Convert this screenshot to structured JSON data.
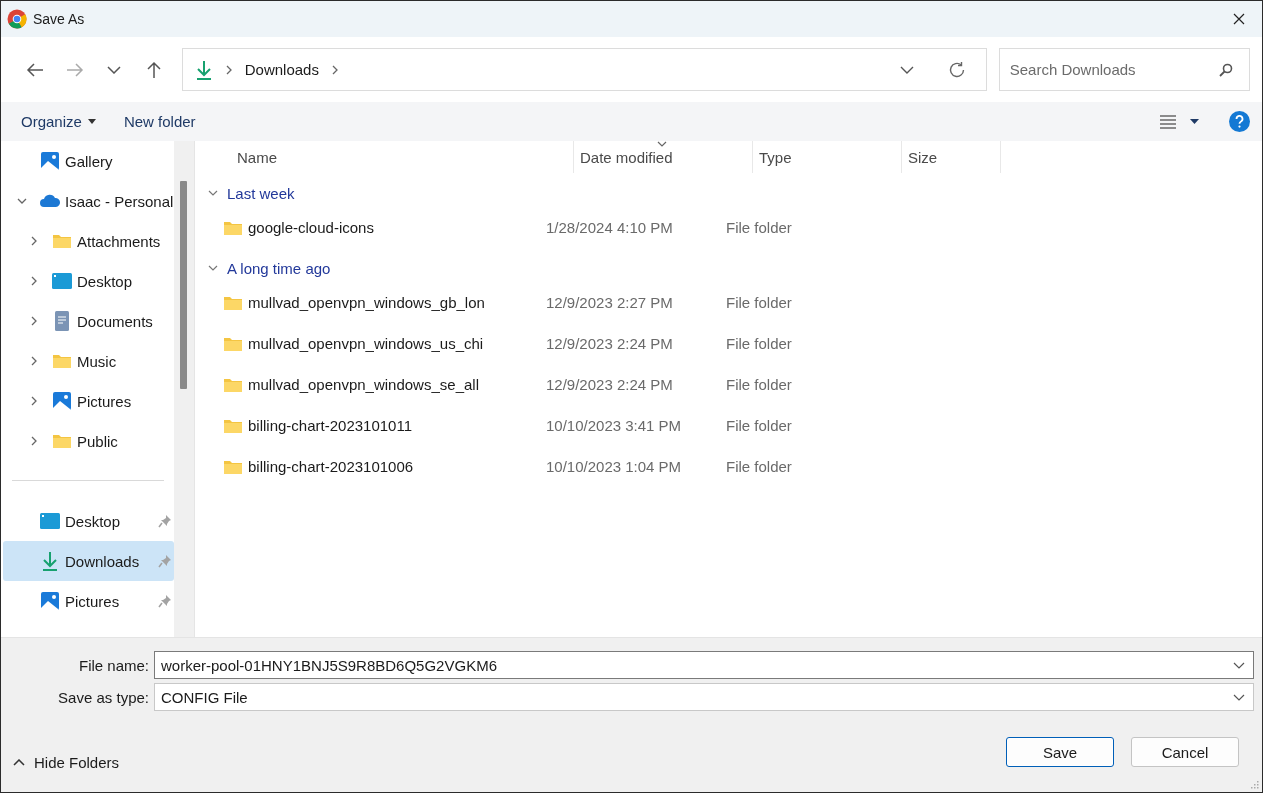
{
  "window": {
    "title": "Save As"
  },
  "address_bar": {
    "path": [
      "Downloads"
    ]
  },
  "search": {
    "placeholder": "Search Downloads"
  },
  "toolbar": {
    "organize": "Organize",
    "new_folder": "New folder"
  },
  "navigation": {
    "items": [
      {
        "label": "Gallery",
        "kind": "gallery",
        "selected": false
      },
      {
        "label": "Isaac - Personal",
        "kind": "cloud",
        "selected": false,
        "expanded": true,
        "children": [
          {
            "label": "Attachments",
            "kind": "folder",
            "selected": false,
            "expanded": false
          },
          {
            "label": "Desktop",
            "kind": "desktop",
            "selected": false,
            "expanded": false
          },
          {
            "label": "Documents",
            "kind": "documents",
            "selected": false,
            "expanded": false
          },
          {
            "label": "Music",
            "kind": "folder",
            "selected": false,
            "expanded": false
          },
          {
            "label": "Pictures",
            "kind": "pictures",
            "selected": false,
            "expanded": false
          },
          {
            "label": "Public",
            "kind": "folder",
            "selected": false,
            "expanded": false
          }
        ]
      }
    ],
    "quick_access": [
      {
        "label": "Desktop",
        "kind": "desktop",
        "selected": false,
        "pinned": true
      },
      {
        "label": "Downloads",
        "kind": "downloads",
        "selected": true,
        "pinned": true
      },
      {
        "label": "Pictures",
        "kind": "pictures",
        "selected": false,
        "pinned": true
      }
    ]
  },
  "file_list": {
    "columns": [
      {
        "label": "Name",
        "sorted": false
      },
      {
        "label": "Date modified",
        "sorted": true
      },
      {
        "label": "Type",
        "sorted": false
      },
      {
        "label": "Size",
        "sorted": false
      }
    ],
    "groups": [
      {
        "title": "Last week",
        "expanded": true,
        "rows": [
          {
            "name": "google-cloud-icons",
            "date": "1/28/2024 4:10 PM",
            "type": "File folder"
          }
        ]
      },
      {
        "title": "A long time ago",
        "expanded": true,
        "rows": [
          {
            "name": "mullvad_openvpn_windows_gb_lon",
            "date": "12/9/2023 2:27 PM",
            "type": "File folder"
          },
          {
            "name": "mullvad_openvpn_windows_us_chi",
            "date": "12/9/2023 2:24 PM",
            "type": "File folder"
          },
          {
            "name": "mullvad_openvpn_windows_se_all",
            "date": "12/9/2023 2:24 PM",
            "type": "File folder"
          },
          {
            "name": "billing-chart-2023101011",
            "date": "10/10/2023 3:41 PM",
            "type": "File folder"
          },
          {
            "name": "billing-chart-2023101006",
            "date": "10/10/2023 1:04 PM",
            "type": "File folder"
          }
        ]
      }
    ]
  },
  "file_name": {
    "label": "File name:",
    "value": "worker-pool-01HNY1BNJ5S9R8BD6Q5G2VGKM6"
  },
  "save_type": {
    "label": "Save as type:",
    "value": "CONFIG File"
  },
  "hide_folders": {
    "label": "Hide Folders"
  },
  "buttons": [
    {
      "label": "Save",
      "default": true
    },
    {
      "label": "Cancel",
      "default": false
    }
  ]
}
